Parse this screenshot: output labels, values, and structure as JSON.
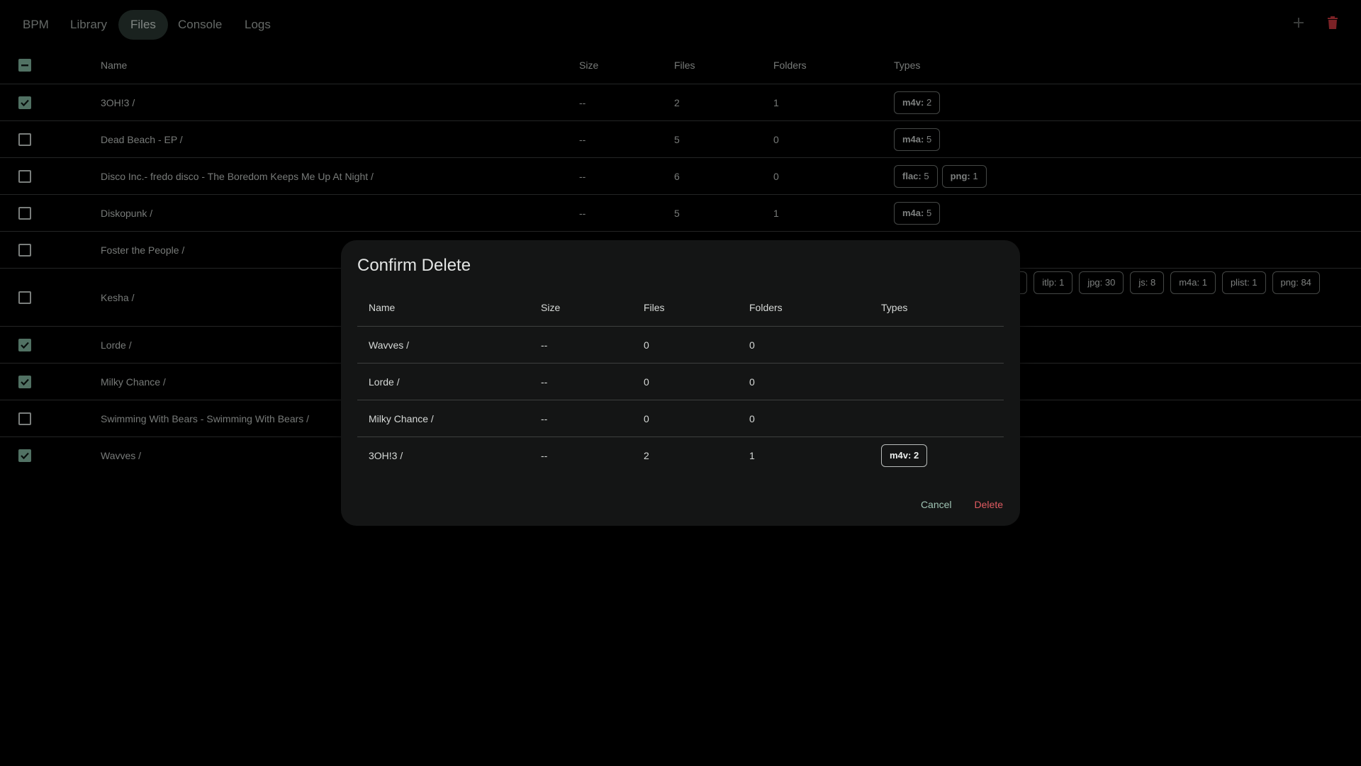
{
  "nav": {
    "tabs": [
      "BPM",
      "Library",
      "Files",
      "Console",
      "Logs"
    ],
    "active_tab": "Files",
    "add_icon": "plus-icon",
    "delete_icon": "trash-icon",
    "delete_color": "#c8373e"
  },
  "table": {
    "headers": {
      "name": "Name",
      "size": "Size",
      "files": "Files",
      "folders": "Folders",
      "types": "Types"
    },
    "select_all_state": "indeterminate",
    "rows": [
      {
        "checked": true,
        "name": "3OH!3 /",
        "size": "--",
        "files": "2",
        "folders": "1",
        "types": [
          {
            "ext": "m4v:",
            "count": "2"
          }
        ]
      },
      {
        "checked": false,
        "name": "Dead Beach - EP /",
        "size": "--",
        "files": "5",
        "folders": "0",
        "types": [
          {
            "ext": "m4a:",
            "count": "5"
          }
        ]
      },
      {
        "checked": false,
        "name": "Disco Inc.- fredo disco - The Boredom Keeps Me Up At Night /",
        "size": "--",
        "files": "6",
        "folders": "0",
        "types": [
          {
            "ext": "flac:",
            "count": "5"
          },
          {
            "ext": "png:",
            "count": "1"
          }
        ]
      },
      {
        "checked": false,
        "name": "Diskopunk /",
        "size": "--",
        "files": "5",
        "folders": "1",
        "types": [
          {
            "ext": "m4a:",
            "count": "5"
          }
        ]
      },
      {
        "checked": false,
        "name": "Foster the People /"
      },
      {
        "checked": false,
        "name": "Kesha /",
        "types_partial": [
          "7",
          "itlp: 1",
          "jpg: 30",
          "js: 8",
          "m4a: 1",
          "plist: 1",
          "png: 84"
        ]
      },
      {
        "checked": true,
        "name": "Lorde /"
      },
      {
        "checked": true,
        "name": "Milky Chance /"
      },
      {
        "checked": false,
        "name": "Swimming With Bears - Swimming With Bears /"
      },
      {
        "checked": true,
        "name": "Wavves /"
      }
    ]
  },
  "dialog": {
    "title": "Confirm Delete",
    "headers": {
      "name": "Name",
      "size": "Size",
      "files": "Files",
      "folders": "Folders",
      "types": "Types"
    },
    "rows": [
      {
        "name": "Wavves /",
        "size": "--",
        "files": "0",
        "folders": "0",
        "types": ""
      },
      {
        "name": "Lorde /",
        "size": "--",
        "files": "0",
        "folders": "0",
        "types": ""
      },
      {
        "name": "Milky Chance /",
        "size": "--",
        "files": "0",
        "folders": "0",
        "types": ""
      },
      {
        "name": "3OH!3 /",
        "size": "--",
        "files": "2",
        "folders": "1",
        "types": "m4v: 2"
      }
    ],
    "cancel_label": "Cancel",
    "delete_label": "Delete"
  },
  "colors": {
    "accent": "#83b6a1",
    "danger": "#e05b61"
  }
}
